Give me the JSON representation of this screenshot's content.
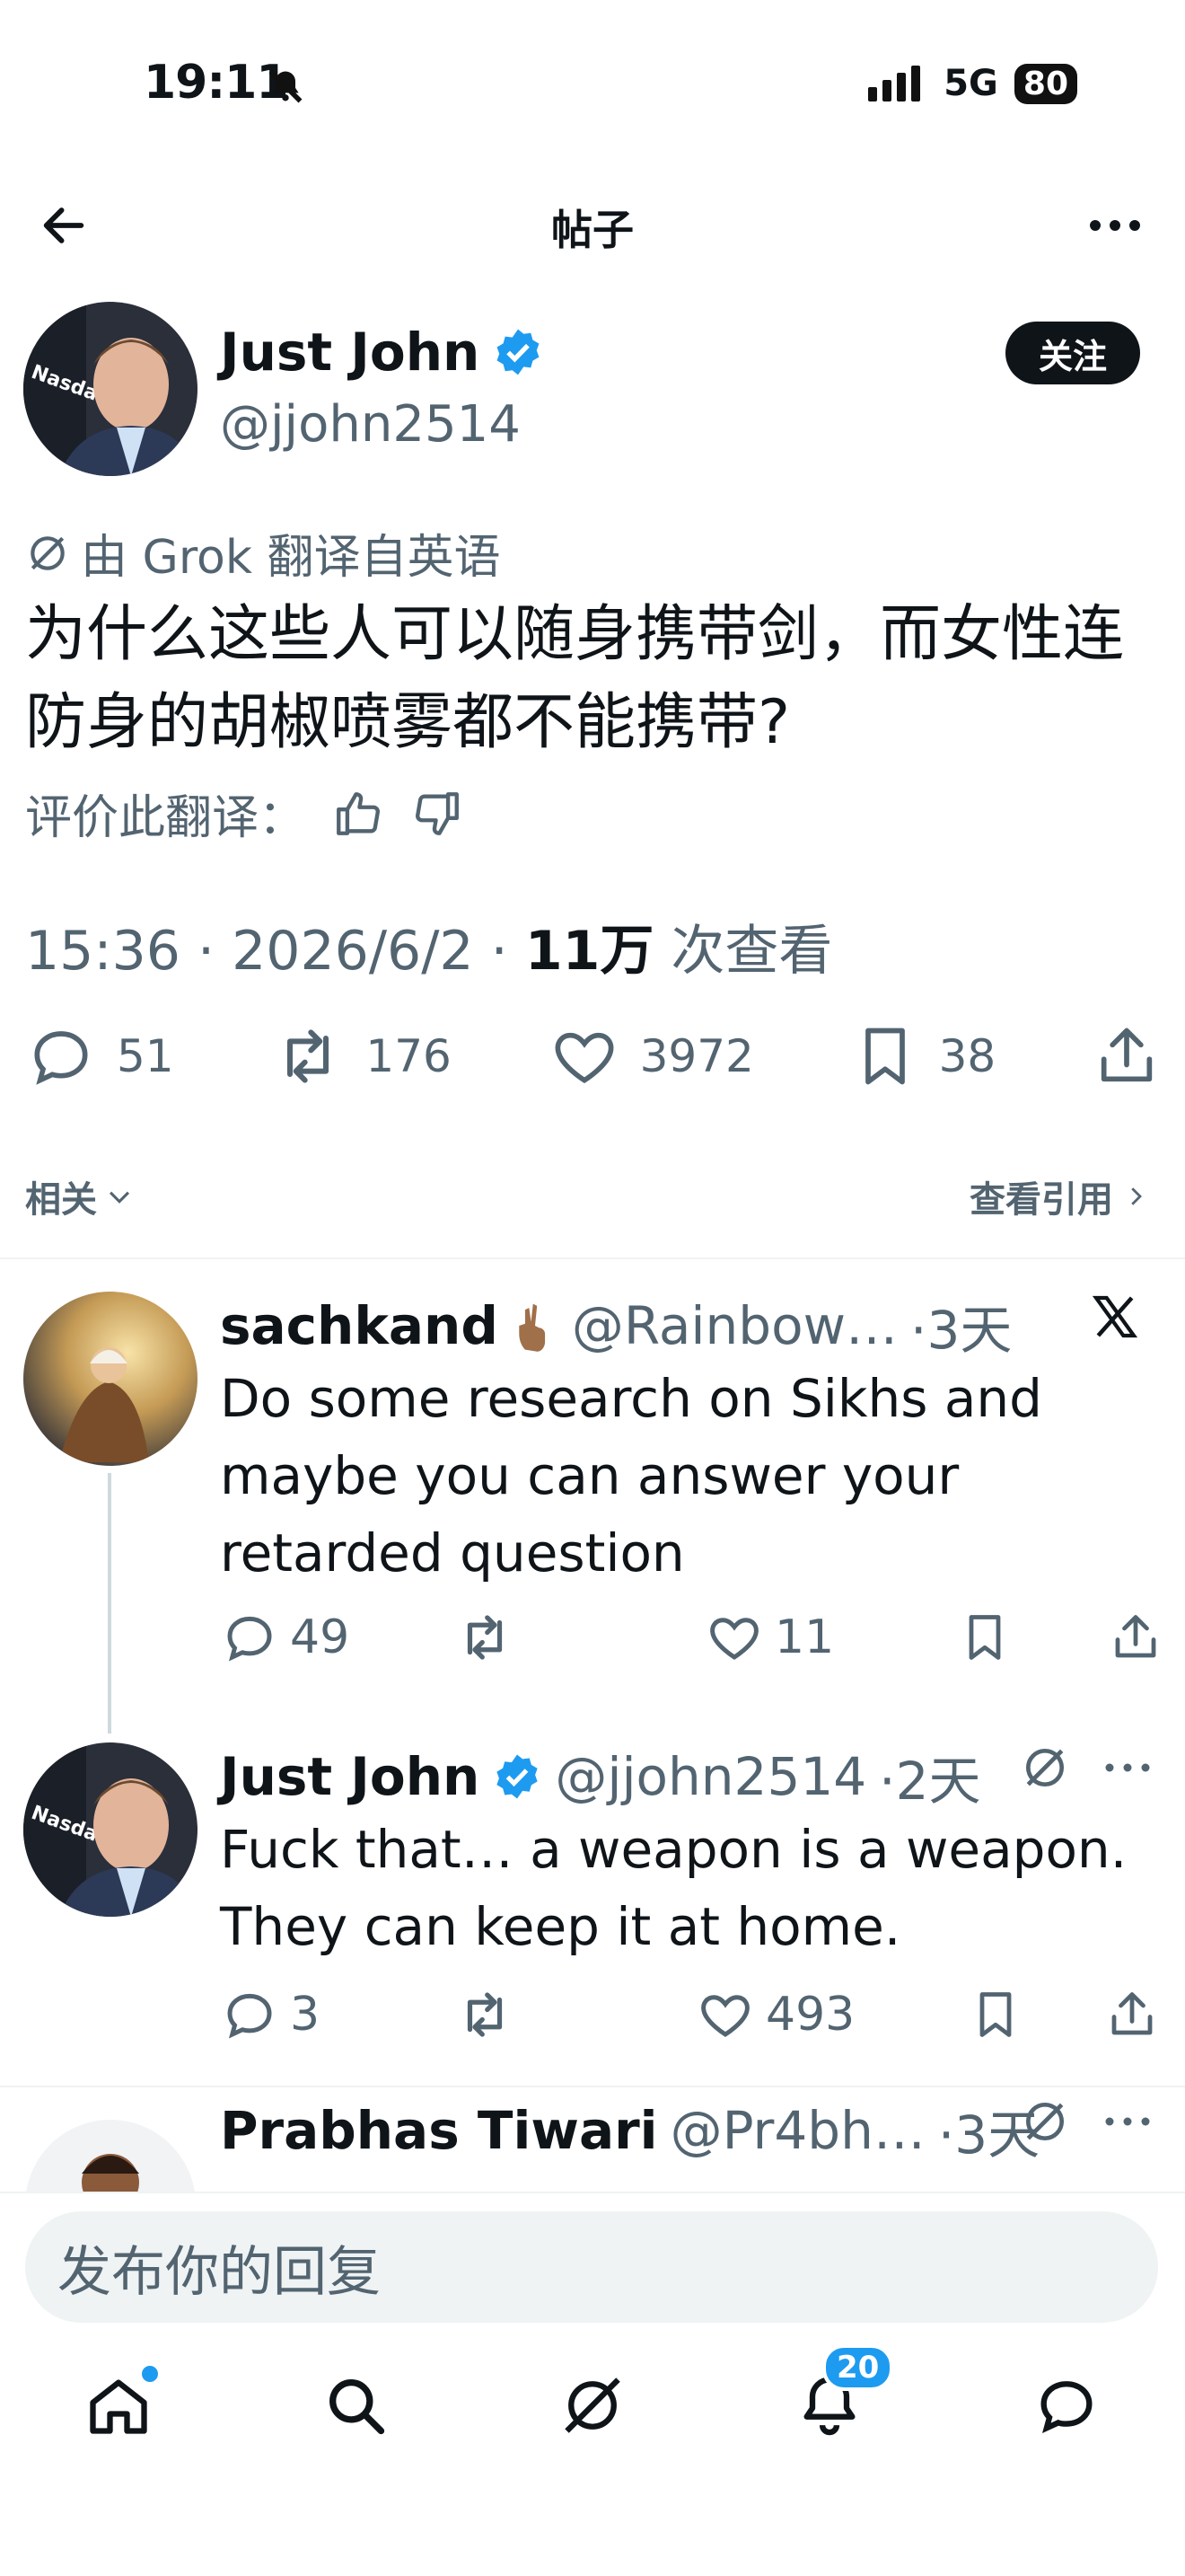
{
  "status": {
    "time": "19:11",
    "network": "5G",
    "battery": "80"
  },
  "header": {
    "title": "帖子"
  },
  "post": {
    "author_name": "Just John",
    "handle": "@jjohn2514",
    "follow_label": "关注",
    "translated_label": "由 Grok 翻译自英语",
    "text": "为什么这些人可以随身携带剑，而女性连防身的胡椒喷雾都不能携带?",
    "rate_label": "评价此翻译：",
    "time": "15:36 · 2026/6/2 · ",
    "views": "11万",
    "views_label": " 次查看",
    "stats": {
      "replies": "51",
      "reposts": "176",
      "likes": "3972",
      "bookmarks": "38"
    }
  },
  "related": {
    "sort_label": "相关",
    "quotes_label": "查看引用"
  },
  "replies": [
    {
      "name": "sachkand",
      "handle": "@Rainbow…",
      "time": "·3天",
      "text": "Do some research on Sikhs and maybe you can answer your retarded question",
      "stats": {
        "replies": "49",
        "likes": "11"
      }
    },
    {
      "name": "Just John",
      "handle": "@jjohn2514",
      "time": "·2天",
      "text": "Fuck that… a weapon is a weapon. They can keep it at home.",
      "stats": {
        "replies": "3",
        "likes": "493"
      }
    },
    {
      "name": "Prabhas Tiwari",
      "handle": "@Pr4bh…",
      "time": "·3天"
    }
  ],
  "compose": {
    "placeholder": "发布你的回复"
  },
  "nav": {
    "notifications_badge": "20"
  },
  "colors": {
    "accent": "#1d9bf0",
    "text": "#0f1419",
    "muted": "#536471"
  }
}
